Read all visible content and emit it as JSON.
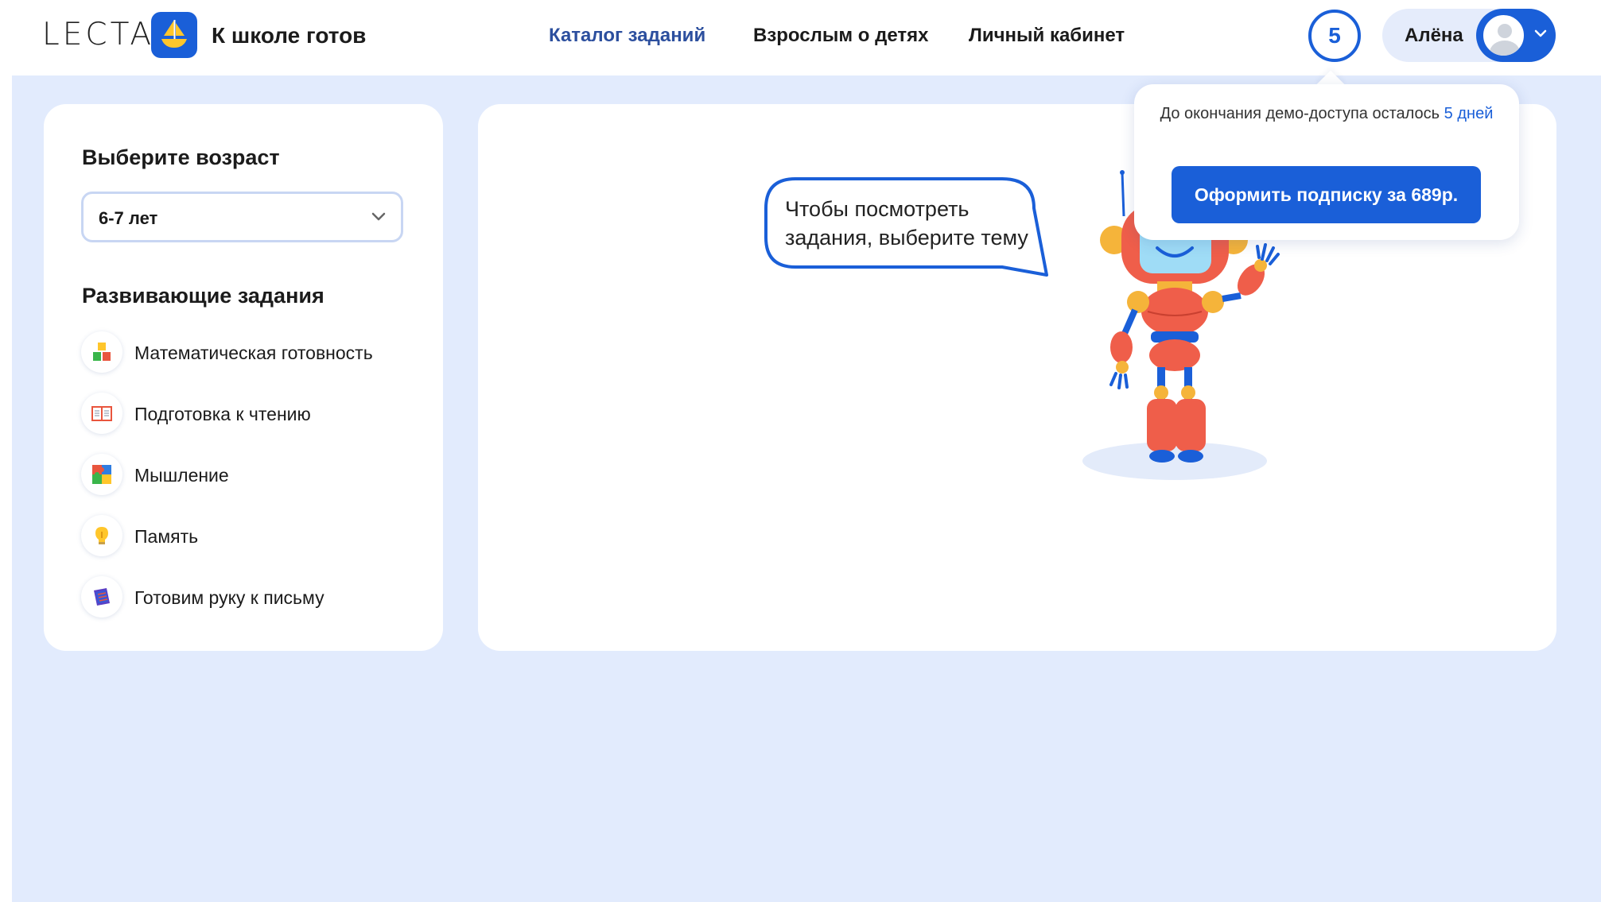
{
  "header": {
    "logo_text": "LECTA",
    "app_title": "К школе готов",
    "nav": [
      {
        "label": "Каталог заданий",
        "active": true
      },
      {
        "label": "Взрослым о детях",
        "active": false
      },
      {
        "label": "Личный кабинет",
        "active": false
      }
    ],
    "counter": "5",
    "user_name": "Алёна"
  },
  "sidebar": {
    "age_heading": "Выберите возраст",
    "age_selected": "6-7 лет",
    "tasks_heading": "Развивающие задания",
    "tasks": [
      {
        "label": "Математическая готовность",
        "icon": "math-blocks-icon"
      },
      {
        "label": "Подготовка к чтению",
        "icon": "open-book-icon"
      },
      {
        "label": "Мышление",
        "icon": "puzzle-icon"
      },
      {
        "label": "Память",
        "icon": "lightbulb-icon"
      },
      {
        "label": "Готовим руку к письму",
        "icon": "notebook-icon"
      }
    ]
  },
  "main": {
    "bubble_text": "Чтобы посмотреть задания, выберите тему"
  },
  "popover": {
    "text_before": "До окончания демо-доступа осталось ",
    "days": "5 дней",
    "button_label": "Оформить подписку за 689р."
  },
  "colors": {
    "brand_blue": "#1a5fd8",
    "page_bg": "#e2ebfd",
    "nav_active": "#2c4f9e"
  }
}
